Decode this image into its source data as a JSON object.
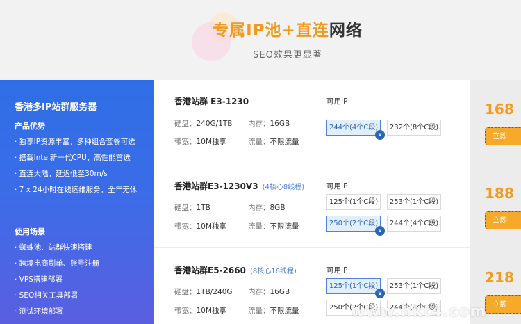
{
  "hero": {
    "title_part1": "专属IP池",
    "plus": "+",
    "title_part2": "直连",
    "title_part3": "网络",
    "subtitle": "SEO效果更显著"
  },
  "sidebar": {
    "title": "香港多IP站群服务器",
    "section1_title": "产品优势",
    "section1_items": [
      "· 独享IP资源丰富，多种组合套餐可选",
      "· 搭载Intel新一代CPU，高性能首选",
      "· 直连大陆，延迟低至30m/s",
      "· 7 x 24小时在线运维服务，全年无休"
    ],
    "section2_title": "使用场景",
    "section2_items": [
      "· 蜘蛛池、站群快速搭建",
      "· 跨境电商刷单、账号注册",
      "· VPS搭建部署",
      "· SEO相关工具部署",
      "· 测试环境部署"
    ]
  },
  "labels": {
    "disk": "硬盘：",
    "mem": "内存：",
    "bandwidth": "带宽：",
    "traffic": "流量：",
    "ip": "可用IP",
    "buy": "立即"
  },
  "products": [
    {
      "name": "香港站群 E3-1230",
      "badge": "",
      "disk": "240G/1TB",
      "mem": "16GB",
      "bandwidth": "10M独享",
      "traffic": "不限流量",
      "ip_options": [
        "244个(4个C段)",
        "232个(8个C段)"
      ],
      "price": "168"
    },
    {
      "name": "香港站群E3-1230V3",
      "badge": "(4核心8线程)",
      "disk": "1TB",
      "mem": "8GB",
      "bandwidth": "10M独享",
      "traffic": "不限流量",
      "ip_options": [
        "125个(1个C段)",
        "253个(1个C段)",
        "250个(2个C段)",
        "244个(4个C段)"
      ],
      "price": "188"
    },
    {
      "name": "香港站群E5-2660",
      "badge": "(8核心16线程)",
      "disk": "1TB/240G",
      "mem": "16GB",
      "bandwidth": "10M独享",
      "traffic": "不限流量",
      "ip_options": [
        "125个(1个C段)",
        "253个(1个C段)",
        "250个(2个C段)",
        "244个(4个C段)"
      ],
      "price": "218"
    }
  ],
  "check_mark": "v",
  "watermark": "www.hkt4.com"
}
